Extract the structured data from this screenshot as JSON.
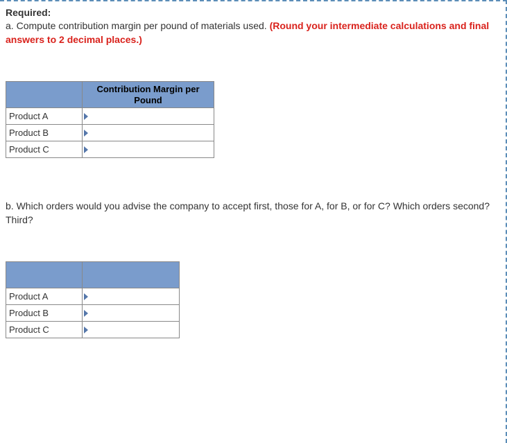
{
  "required_label": "Required:",
  "part_a": {
    "prefix": "a. ",
    "text": "Compute contribution margin per pound of materials used. ",
    "emph": "(Round your intermediate calculations and final answers to 2 decimal places.)"
  },
  "chart_data": {
    "type": "table",
    "tables": [
      {
        "header_blank": "",
        "header_col": "Contribution Margin per Pound",
        "rows": [
          {
            "label": "Product A",
            "value": ""
          },
          {
            "label": "Product B",
            "value": ""
          },
          {
            "label": "Product C",
            "value": ""
          }
        ]
      },
      {
        "header_blank": "",
        "header_col": "",
        "rows": [
          {
            "label": "Product A",
            "value": ""
          },
          {
            "label": "Product B",
            "value": ""
          },
          {
            "label": "Product C",
            "value": ""
          }
        ]
      }
    ]
  },
  "part_b": {
    "prefix": "b. ",
    "text": "Which orders would you advise the company to accept first, those for A, for B, or for C? Which orders second? Third?"
  }
}
